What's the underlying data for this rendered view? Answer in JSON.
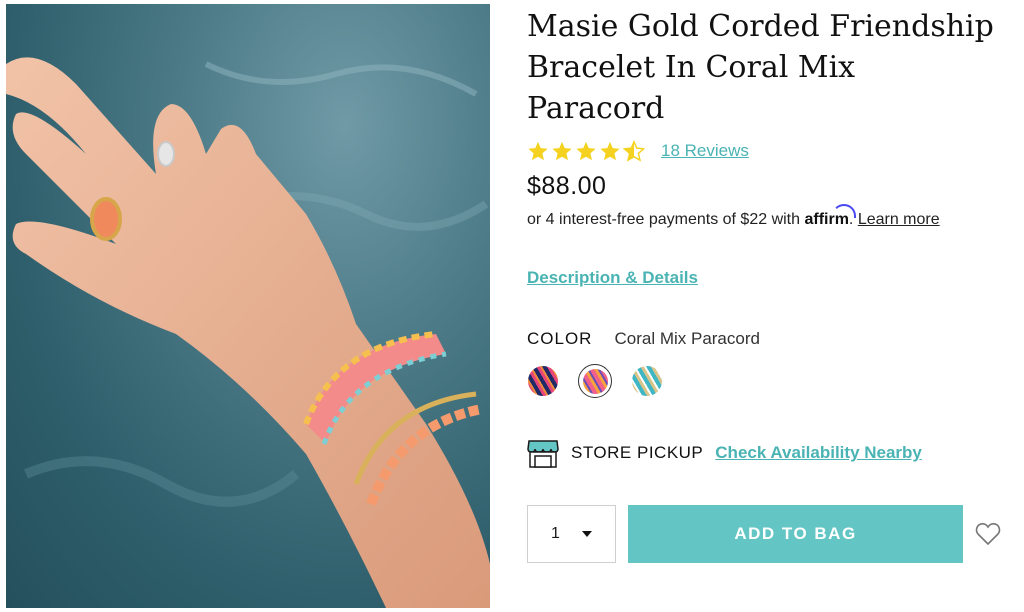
{
  "product": {
    "title": "Masie Gold Corded Friendship Bracelet In Coral Mix Paracord",
    "rating": 4.5,
    "reviews_label": "18 Reviews",
    "price": "$88.00",
    "financing": {
      "prefix": "or 4 interest-free payments of $22 with ",
      "logo_text": "affirm",
      "suffix": ". ",
      "link_label": "Learn more"
    },
    "description_link": "Description & Details",
    "color": {
      "label": "COLOR",
      "selected_value": "Coral Mix Paracord",
      "swatches": [
        {
          "name": "navy-pink",
          "colors": [
            "#1f2a66",
            "#e8467a",
            "#f08b3c"
          ]
        },
        {
          "name": "coral-mix",
          "colors": [
            "#f0608a",
            "#f7a23c",
            "#6b4fb8"
          ]
        },
        {
          "name": "teal-gold",
          "colors": [
            "#3fb6c4",
            "#d9c58a",
            "#ffffff"
          ]
        }
      ]
    },
    "store_pickup": {
      "label": "STORE PICKUP",
      "link_label": "Check Availability Nearby"
    },
    "quantity": "1",
    "add_to_bag_label": "ADD TO BAG"
  },
  "colors": {
    "accent": "#4ab3b3",
    "button": "#63c6c4",
    "star": "#f4d21f"
  },
  "icons": {
    "wishlist": "heart-outline-icon",
    "store": "storefront-icon",
    "quantity_dropdown": "caret-down-icon"
  }
}
